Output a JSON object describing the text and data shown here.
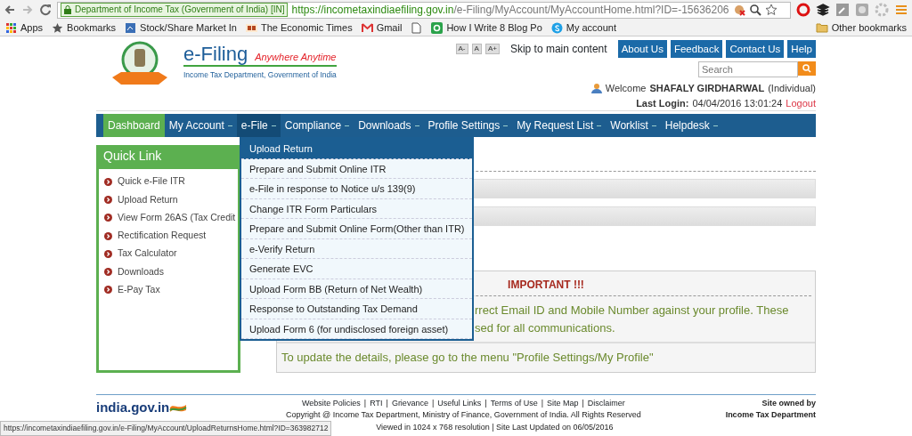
{
  "browser": {
    "ev_label": "Department of Income Tax (Government of India) [IN]",
    "url_host": "https://incometaxindiaefiling.gov.in",
    "url_path": "/e-Filing/MyAccount/MyAccountHome.html?ID=-15636206",
    "bookmarks": [
      {
        "label": "Apps",
        "kind": "apps"
      },
      {
        "label": "Bookmarks",
        "kind": "star"
      },
      {
        "label": "Stock/Share Market In",
        "kind": "site"
      },
      {
        "label": "The Economic Times",
        "kind": "et"
      },
      {
        "label": "Gmail",
        "kind": "gmail"
      },
      {
        "kind": "page"
      },
      {
        "label": "How I Write 8 Blog Po",
        "kind": "q"
      },
      {
        "label": "My account",
        "kind": "skype"
      }
    ],
    "other_bookmarks": "Other bookmarks"
  },
  "header": {
    "title": "e-Filing",
    "tagline": "Anywhere Anytime",
    "subtitle": "Income Tax Department, Government of India",
    "font_buttons": [
      "A-",
      "A",
      "A+"
    ],
    "skip_link": "Skip to main content",
    "top_buttons": [
      "About Us",
      "Feedback",
      "Contact Us",
      "Help"
    ],
    "search": {
      "placeholder": "Search"
    },
    "welcome": "Welcome",
    "user_name": "SHAFALY GIRDHARWAL",
    "user_type": "(Individual)",
    "last_login_label": "Last Login:",
    "last_login": "04/04/2016 13:01:24",
    "logout": "Logout"
  },
  "nav": [
    {
      "label": "Dashboard",
      "selected": true,
      "dropdown": false,
      "expanded": false
    },
    {
      "label": "My Account",
      "selected": false,
      "dropdown": true,
      "expanded": false
    },
    {
      "label": "e-File",
      "selected": false,
      "dropdown": true,
      "expanded": true
    },
    {
      "label": "Compliance",
      "selected": false,
      "dropdown": true,
      "expanded": false
    },
    {
      "label": "Downloads",
      "selected": false,
      "dropdown": true,
      "expanded": false
    },
    {
      "label": "Profile Settings",
      "selected": false,
      "dropdown": true,
      "expanded": false
    },
    {
      "label": "My Request List",
      "selected": false,
      "dropdown": true,
      "expanded": false
    },
    {
      "label": "Worklist",
      "selected": false,
      "dropdown": true,
      "expanded": false
    },
    {
      "label": "Helpdesk",
      "selected": false,
      "dropdown": true,
      "expanded": false
    }
  ],
  "efile_menu": [
    {
      "label": "Upload Return",
      "selected": true
    },
    {
      "label": "Prepare and Submit Online ITR",
      "selected": false
    },
    {
      "label": "e-File in response to Notice u/s 139(9)",
      "selected": false
    },
    {
      "label": "Change ITR Form Particulars",
      "selected": false
    },
    {
      "label": "Prepare and Submit Online Form(Other than ITR)",
      "selected": false
    },
    {
      "label": "e-Verify Return",
      "selected": false
    },
    {
      "label": "Generate EVC",
      "selected": false
    },
    {
      "label": "Upload Form BB (Return of Net Wealth)",
      "selected": false
    },
    {
      "label": "Response to Outstanding Tax Demand",
      "selected": false
    },
    {
      "label": "Upload Form 6 (for undisclosed foreign asset)",
      "selected": false
    }
  ],
  "quick_link": {
    "title": "Quick Link",
    "items": [
      "Quick e-File ITR",
      "Upload Return",
      "View Form 26AS (Tax Credit",
      "Rectification Request",
      "Tax Calculator",
      "Downloads",
      "E-Pay Tax"
    ]
  },
  "notice": {
    "title": "IMPORTANT !!!",
    "message_lines": [
      "rrect Email ID and Mobile Number against your profile. These",
      "sed for all communications."
    ],
    "update_text": "To update the details, please go to the menu \"Profile Settings/My Profile\""
  },
  "footer": {
    "portal": "india.gov.in",
    "links": [
      "Website Policies",
      "RTI",
      "Grievance",
      "Useful Links",
      "Terms of Use",
      "Site Map",
      "Disclaimer"
    ],
    "separator": "|",
    "copyright": "Copyright @ Income Tax Department, Ministry of Finance, Government of India. All Rights Reserved",
    "viewed": "Viewed in 1024 x 768 resolution | Site Last Updated on 06/05/2016",
    "owner_line1": "Site owned by",
    "owner_line2": "Income Tax Department"
  },
  "status_url": "https://incometaxindiaefiling.gov.in/e-Filing/MyAccount/UploadReturnsHome.html?ID=363982712"
}
